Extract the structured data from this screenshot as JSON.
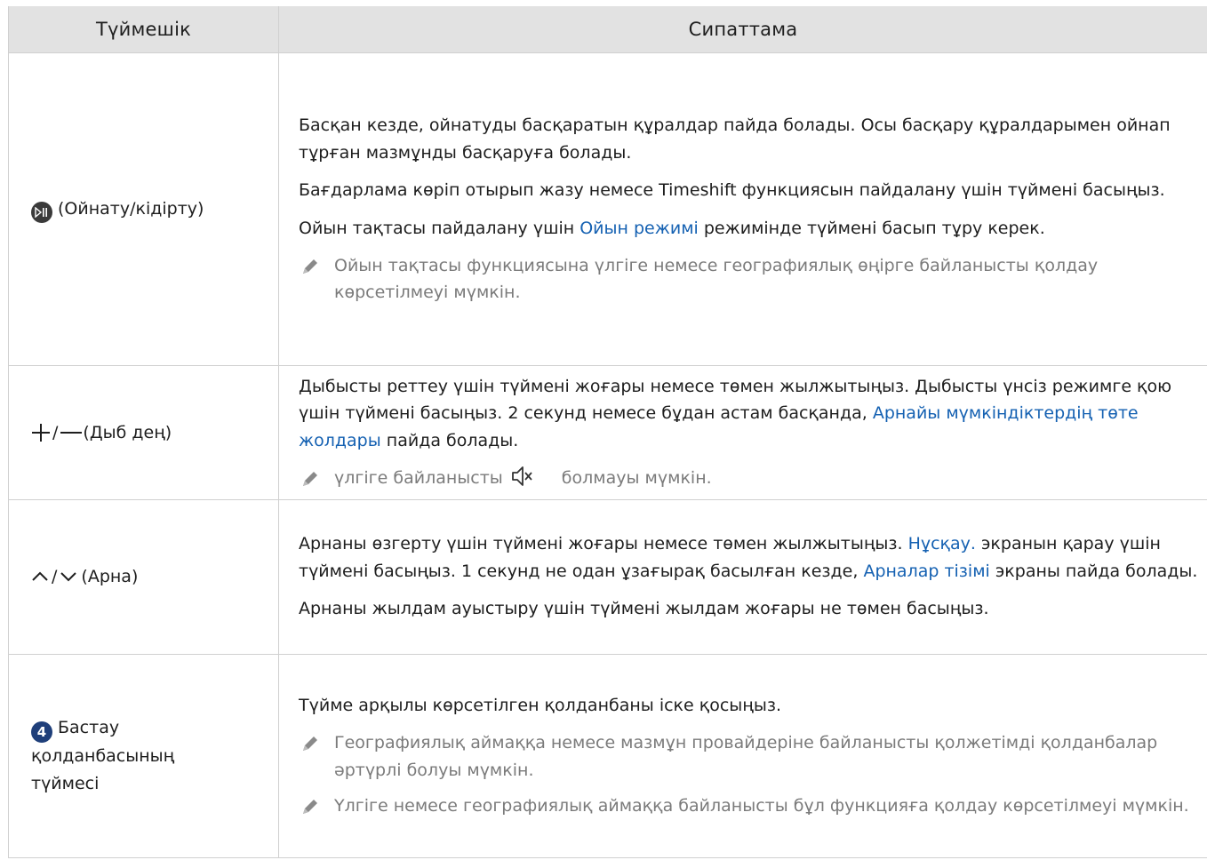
{
  "header": {
    "col_button": "Түймешік",
    "col_description": "Сипаттама"
  },
  "rows": [
    {
      "key_icon": "play-pause-icon",
      "key_label": "(Ойнату/кідірту)",
      "p1": "Басқан кезде, ойнатуды басқаратын құралдар пайда болады. Осы басқару құралдарымен ойнап тұрған мазмұнды басқаруға болады.",
      "p2": "Бағдарлама көріп отырып жазу немесе Timeshift функциясын пайдалану үшін түймені басыңыз.",
      "p3_pre": "Ойын тақтасы пайдалану үшін ",
      "p3_link": "Ойын режимі",
      "p3_post": " режимінде түймені басып тұру керек.",
      "note1": "Ойын тақтасы функциясына үлгіге немесе географиялық өңірге байланысты қолдау көрсетілмеуі мүмкін."
    },
    {
      "key_icon": "plus-minus-icon",
      "key_label": "(Дыб дең)",
      "p1_pre": "Дыбысты реттеу үшін түймені жоғары немесе төмен жылжытыңыз. Дыбысты үнсіз режимге қою үшін түймені басыңыз. 2 секунд немесе бұдан астам басқанда, ",
      "p1_link": "Арнайы мүмкіндіктердің төте жолдары",
      "p1_post": " пайда болады.",
      "note1_pre": "үлгіге байланысты",
      "note1_icon": "mute-icon",
      "note1_post": "болмауы мүмкін."
    },
    {
      "key_icon": "channel-up-down-icon",
      "key_label": "(Арна)",
      "p1_pre": "Арнаны өзгерту үшін түймені жоғары немесе төмен жылжытыңыз. ",
      "p1_link1": "Нұсқау.",
      "p1_mid": " экранын қарау үшін түймені басыңыз. 1 секунд не одан ұзағырақ басылған кезде, ",
      "p1_link2": "Арналар тізімі",
      "p1_post": " экраны пайда болады.",
      "p2": "Арнаны жылдам ауыстыру үшін түймені жылдам жоғары не төмен басыңыз."
    },
    {
      "key_badge": "4",
      "key_label": "Бастау қолданбасының түймесі",
      "p1": "Түйме арқылы көрсетілген қолданбаны іске қосыңыз.",
      "note1": "Географиялық аймаққа немесе мазмұн провайдеріне байланысты қолжетімді қолданбалар әртүрлі болуы мүмкін.",
      "note2": "Үлгіге немесе географиялық аймаққа байланысты бұл функцияға қолдау көрсетілмеуі мүмкін."
    }
  ],
  "colors": {
    "header_bg": "#e2e2e2",
    "link": "#1561b2",
    "note": "#7b7b7b",
    "border": "#d0d0d0"
  }
}
